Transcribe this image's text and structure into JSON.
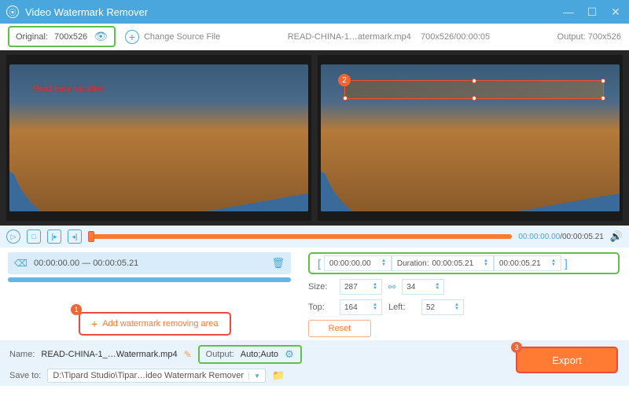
{
  "titlebar": {
    "title": "Video Watermark Remover"
  },
  "toolbar": {
    "original_label": "Original:",
    "original_dim": "700x526",
    "change_source": "Change Source File",
    "filename": "READ-CHINA-1…atermark.mp4",
    "file_meta": "700x526/00:00:05",
    "output_label": "Output:",
    "output_dim": "700x526"
  },
  "preview": {
    "watermark_text": "Read easy not alter!",
    "marker2": "2"
  },
  "playbar": {
    "current": "00:00:00.00",
    "total": "00:00:05.21"
  },
  "segment": {
    "range": "00:00:00.00 — 00:00:05.21",
    "add_area": "Add watermark removing area",
    "marker1": "1"
  },
  "props": {
    "start": "00:00:00.00",
    "duration_lbl": "Duration:",
    "duration": "00:00:05.21",
    "end": "00:00:05.21",
    "size_lbl": "Size:",
    "w": "287",
    "h": "34",
    "top_lbl": "Top:",
    "top": "164",
    "left_lbl": "Left:",
    "left": "52",
    "reset": "Reset"
  },
  "footer": {
    "name_lbl": "Name:",
    "name": "READ-CHINA-1_…Watermark.mp4",
    "output_lbl": "Output:",
    "output_val": "Auto;Auto",
    "save_lbl": "Save to:",
    "save_path": "D:\\Tipard Studio\\Tipar…ideo Watermark Remover",
    "export": "Export",
    "marker3": "3"
  }
}
